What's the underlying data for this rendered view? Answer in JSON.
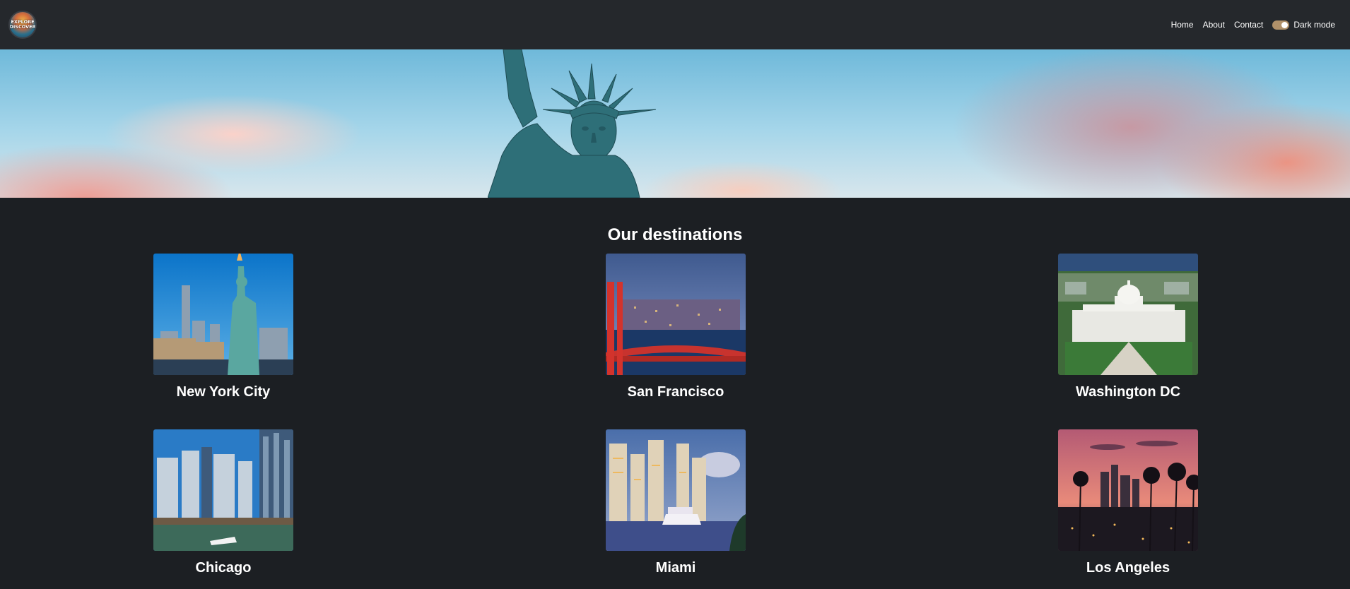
{
  "navbar": {
    "logo_text": [
      "EXPLORE",
      "DISCOVER"
    ],
    "links": [
      {
        "label": "Home"
      },
      {
        "label": "About"
      },
      {
        "label": "Contact"
      }
    ],
    "dark_mode_label": "Dark mode",
    "dark_mode_on": true
  },
  "main": {
    "title": "Our destinations",
    "destinations": [
      {
        "name": "New York City"
      },
      {
        "name": "San Francisco"
      },
      {
        "name": "Washington DC"
      },
      {
        "name": "Chicago"
      },
      {
        "name": "Miami"
      },
      {
        "name": "Los Angeles"
      }
    ]
  },
  "colors": {
    "background": "#1c1f23",
    "navbar": "#25282c",
    "toggle": "#b0916a"
  }
}
